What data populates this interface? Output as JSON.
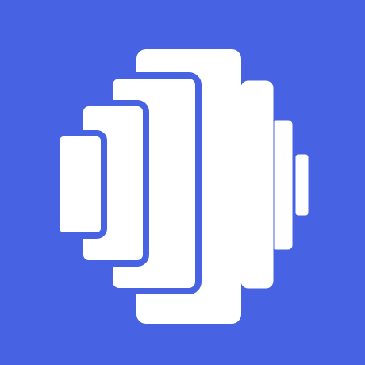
{
  "app_icon": {
    "background_color": "#4763E4",
    "foreground_color": "#FFFFFF",
    "icon_name": "stacked-layers-logo-icon"
  }
}
